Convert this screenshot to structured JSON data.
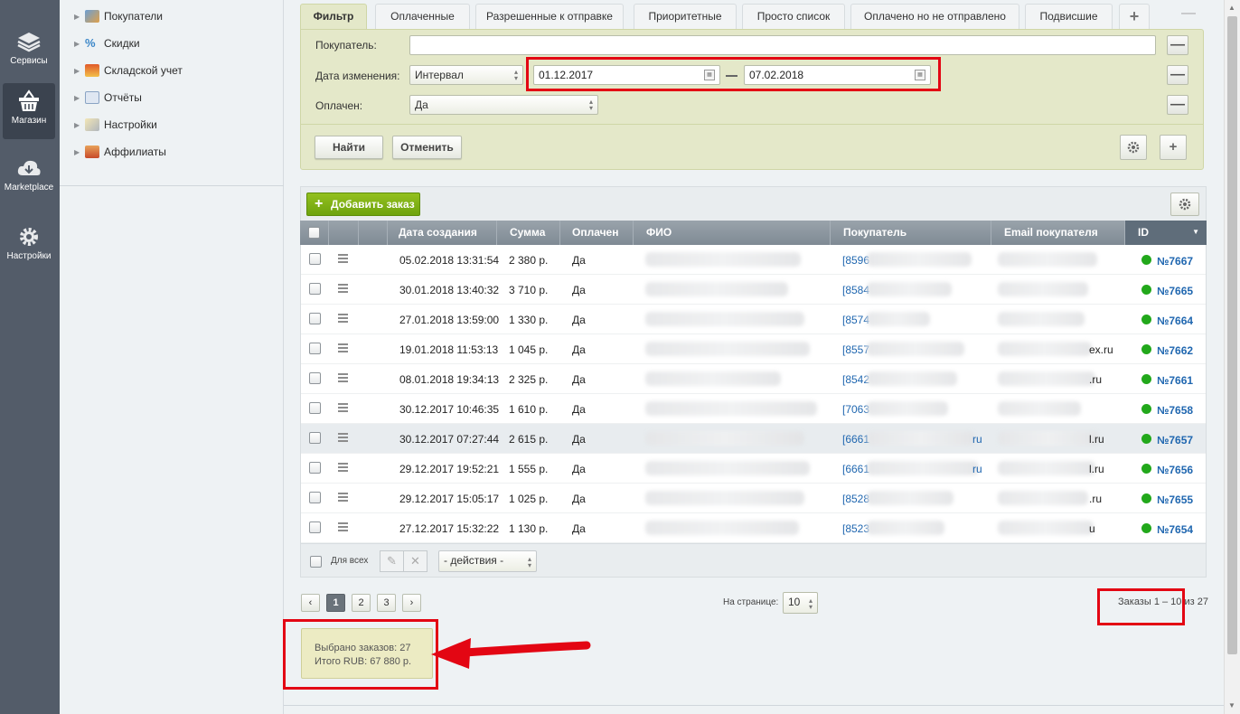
{
  "rail": {
    "items": [
      {
        "label": "Сервисы",
        "icon": "layers-icon"
      },
      {
        "label": "Магазин",
        "icon": "basket-icon"
      },
      {
        "label": "Marketplace",
        "icon": "cloud-download-icon"
      },
      {
        "label": "Настройки",
        "icon": "gear-icon"
      }
    ]
  },
  "tree": {
    "items": [
      {
        "label": "Покупатели",
        "icon": "customers-icon"
      },
      {
        "label": "Скидки",
        "icon": "discount-icon"
      },
      {
        "label": "Складской учет",
        "icon": "warehouse-icon"
      },
      {
        "label": "Отчёты",
        "icon": "reports-icon"
      },
      {
        "label": "Настройки",
        "icon": "settings-icon"
      },
      {
        "label": "Аффилиаты",
        "icon": "affiliates-icon"
      }
    ]
  },
  "tabs": [
    {
      "label": "Фильтр"
    },
    {
      "label": "Оплаченные"
    },
    {
      "label": "Разрешенные к отправке"
    },
    {
      "label": "Приоритетные"
    },
    {
      "label": "Просто список"
    },
    {
      "label": "Оплачено но не отправлено"
    },
    {
      "label": "Подвисшие"
    },
    {
      "label": "+"
    }
  ],
  "tabs_collapse": "—",
  "filter": {
    "buyer_label": "Покупатель:",
    "buyer_value": "",
    "date_label": "Дата изменения:",
    "date_mode": "Интервал",
    "date_from": "01.12.2017",
    "date_to": "07.02.2018",
    "paid_label": "Оплачен:",
    "paid_value": "Да",
    "find_button": "Найти",
    "cancel_button": "Отменить",
    "minus": "—",
    "plus": "+"
  },
  "grid": {
    "add_button": "Добавить заказ",
    "columns": {
      "created": "Дата создания",
      "sum": "Сумма",
      "paid": "Оплачен",
      "fio": "ФИО",
      "buyer": "Покупатель",
      "email": "Email покупателя",
      "id": "ID"
    },
    "rows": [
      {
        "date": "05.02.2018 13:31:54",
        "sum": "2 380 р.",
        "paid": "Да",
        "buyer": "[8596",
        "email_tail": "",
        "buyer_tail": "",
        "id": "№7667"
      },
      {
        "date": "30.01.2018 13:40:32",
        "sum": "3 710 р.",
        "paid": "Да",
        "buyer": "[8584",
        "email_tail": "",
        "buyer_tail": "",
        "id": "№7665"
      },
      {
        "date": "27.01.2018 13:59:00",
        "sum": "1 330 р.",
        "paid": "Да",
        "buyer": "[8574",
        "email_tail": "",
        "buyer_tail": "",
        "id": "№7664"
      },
      {
        "date": "19.01.2018 11:53:13",
        "sum": "1 045 р.",
        "paid": "Да",
        "buyer": "[8557",
        "email_tail": "ex.ru",
        "buyer_tail": "",
        "id": "№7662"
      },
      {
        "date": "08.01.2018 19:34:13",
        "sum": "2 325 р.",
        "paid": "Да",
        "buyer": "[8542",
        "email_tail": ".ru",
        "buyer_tail": "",
        "id": "№7661"
      },
      {
        "date": "30.12.2017 10:46:35",
        "sum": "1 610 р.",
        "paid": "Да",
        "buyer": "[7063",
        "email_tail": "",
        "buyer_tail": "",
        "id": "№7658"
      },
      {
        "date": "30.12.2017 07:27:44",
        "sum": "2 615 р.",
        "paid": "Да",
        "buyer": "[6661",
        "email_tail": "l.ru",
        "buyer_tail": "ru",
        "id": "№7657"
      },
      {
        "date": "29.12.2017 19:52:21",
        "sum": "1 555 р.",
        "paid": "Да",
        "buyer": "[6661",
        "email_tail": "l.ru",
        "buyer_tail": "ru",
        "id": "№7656"
      },
      {
        "date": "29.12.2017 15:05:17",
        "sum": "1 025 р.",
        "paid": "Да",
        "buyer": "[8528",
        "email_tail": ".ru",
        "buyer_tail": "",
        "id": "№7655"
      },
      {
        "date": "27.12.2017 15:32:22",
        "sum": "1 130 р.",
        "paid": "Да",
        "buyer": "[8523",
        "email_tail": "u",
        "buyer_tail": "",
        "id": "№7654"
      }
    ],
    "for_all_label": "Для всех",
    "actions_select": "- действия -"
  },
  "pager": {
    "prev": "‹",
    "pages": [
      "1",
      "2",
      "3"
    ],
    "next": "›",
    "per_page_label": "На странице:",
    "per_page_value": "10",
    "range_text": "Заказы 1 – 10 из 27"
  },
  "summary": {
    "selected": "Выбрано заказов: 27",
    "total": "Итого RUB: 67 880 р."
  },
  "colors": {
    "accent_green": "#7fb216",
    "highlight_red": "#e30613",
    "filter_bg": "#e4e8c9"
  }
}
